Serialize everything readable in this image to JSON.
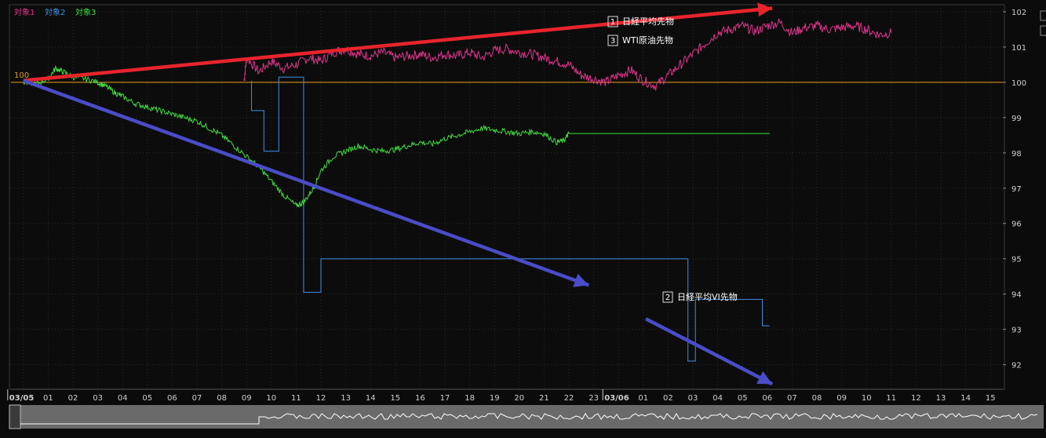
{
  "chart_data": {
    "type": "line",
    "series": [
      {
        "name": "対象1",
        "label": "日経平均先物",
        "badge": "1",
        "color": "#e0348c",
        "points": [
          [
            8.9,
            100.05
          ],
          [
            9.0,
            100.7
          ],
          [
            9.5,
            100.3
          ],
          [
            10.0,
            100.6
          ],
          [
            10.5,
            100.4
          ],
          [
            11.0,
            100.5
          ],
          [
            11.5,
            100.7
          ],
          [
            12.0,
            100.6
          ],
          [
            12.5,
            100.85
          ],
          [
            13.0,
            100.95
          ],
          [
            13.5,
            100.8
          ],
          [
            14.0,
            100.75
          ],
          [
            14.5,
            100.85
          ],
          [
            15.0,
            100.7
          ],
          [
            15.5,
            100.75
          ],
          [
            16.0,
            100.8
          ],
          [
            16.5,
            100.7
          ],
          [
            17.0,
            100.8
          ],
          [
            17.5,
            100.75
          ],
          [
            18.0,
            100.85
          ],
          [
            18.5,
            100.7
          ],
          [
            19.0,
            100.9
          ],
          [
            19.5,
            100.95
          ],
          [
            20.0,
            100.85
          ],
          [
            20.5,
            100.8
          ],
          [
            21.0,
            100.7
          ],
          [
            21.5,
            100.6
          ],
          [
            22.0,
            100.5
          ],
          [
            22.5,
            100.2
          ],
          [
            23.0,
            100.1
          ],
          [
            23.5,
            100.0
          ],
          [
            24.0,
            100.2
          ],
          [
            24.5,
            100.35
          ],
          [
            25.0,
            100.05
          ],
          [
            25.5,
            99.9
          ],
          [
            26.0,
            100.2
          ],
          [
            26.5,
            100.5
          ],
          [
            27.0,
            100.8
          ],
          [
            27.5,
            101.1
          ],
          [
            28.0,
            101.4
          ],
          [
            28.5,
            101.5
          ],
          [
            29.0,
            101.6
          ],
          [
            29.5,
            101.45
          ],
          [
            30.0,
            101.6
          ],
          [
            30.5,
            101.7
          ],
          [
            31.0,
            101.4
          ],
          [
            31.5,
            101.55
          ],
          [
            32.0,
            101.6
          ],
          [
            32.5,
            101.5
          ],
          [
            33.0,
            101.55
          ],
          [
            33.5,
            101.6
          ],
          [
            34.0,
            101.5
          ],
          [
            34.5,
            101.35
          ],
          [
            35.0,
            101.4
          ]
        ]
      },
      {
        "name": "対象2",
        "label": "日経平均VI先物",
        "badge": "2",
        "color": "#3f8fe6",
        "points": [
          [
            9.2,
            100.05
          ],
          [
            9.2,
            99.2
          ],
          [
            9.7,
            99.2
          ],
          [
            9.7,
            98.05
          ],
          [
            10.3,
            98.05
          ],
          [
            10.3,
            100.15
          ],
          [
            11.3,
            100.15
          ],
          [
            11.3,
            94.05
          ],
          [
            12.0,
            94.05
          ],
          [
            12.0,
            95.0
          ],
          [
            26.8,
            95.0
          ],
          [
            26.8,
            92.1
          ],
          [
            27.1,
            92.1
          ],
          [
            27.1,
            93.85
          ],
          [
            29.8,
            93.85
          ],
          [
            29.8,
            93.1
          ],
          [
            30.1,
            93.1
          ]
        ]
      },
      {
        "name": "対象3",
        "label": "WTI原油先物",
        "badge": "3",
        "color": "#3fdc3f",
        "points": [
          [
            0.0,
            100.0
          ],
          [
            0.5,
            99.95
          ],
          [
            1.0,
            100.1
          ],
          [
            1.3,
            100.4
          ],
          [
            1.6,
            100.3
          ],
          [
            2.0,
            100.15
          ],
          [
            2.5,
            100.1
          ],
          [
            3.0,
            100.0
          ],
          [
            3.3,
            99.9
          ],
          [
            3.7,
            99.7
          ],
          [
            4.0,
            99.6
          ],
          [
            4.5,
            99.4
          ],
          [
            5.0,
            99.3
          ],
          [
            5.5,
            99.2
          ],
          [
            6.0,
            99.1
          ],
          [
            6.5,
            99.0
          ],
          [
            7.0,
            98.9
          ],
          [
            7.5,
            98.7
          ],
          [
            8.0,
            98.5
          ],
          [
            8.5,
            98.2
          ],
          [
            9.0,
            97.9
          ],
          [
            9.5,
            97.6
          ],
          [
            10.0,
            97.2
          ],
          [
            10.5,
            96.8
          ],
          [
            11.0,
            96.5
          ],
          [
            11.3,
            96.6
          ],
          [
            11.7,
            97.0
          ],
          [
            12.0,
            97.5
          ],
          [
            12.5,
            97.9
          ],
          [
            13.0,
            98.05
          ],
          [
            13.5,
            98.2
          ],
          [
            14.0,
            98.1
          ],
          [
            14.5,
            98.05
          ],
          [
            15.0,
            98.1
          ],
          [
            15.5,
            98.2
          ],
          [
            16.0,
            98.3
          ],
          [
            16.5,
            98.25
          ],
          [
            17.0,
            98.4
          ],
          [
            17.5,
            98.5
          ],
          [
            18.0,
            98.6
          ],
          [
            18.5,
            98.7
          ],
          [
            19.0,
            98.65
          ],
          [
            19.5,
            98.6
          ],
          [
            20.0,
            98.55
          ],
          [
            20.5,
            98.6
          ],
          [
            21.0,
            98.55
          ],
          [
            21.5,
            98.3
          ],
          [
            21.8,
            98.35
          ],
          [
            22.0,
            98.55
          ],
          [
            25.0,
            98.55
          ],
          [
            30.1,
            98.55
          ]
        ]
      }
    ],
    "legend": [
      "対象1",
      "対象2",
      "対象3"
    ],
    "x_tick_labels": [
      "03/05",
      "01",
      "02",
      "03",
      "04",
      "05",
      "06",
      "07",
      "08",
      "09",
      "10",
      "11",
      "12",
      "13",
      "14",
      "15",
      "16",
      "17",
      "18",
      "19",
      "20",
      "21",
      "22",
      "23",
      "03/06",
      "01",
      "02",
      "03",
      "04",
      "05",
      "06",
      "07",
      "08",
      "09",
      "10",
      "11",
      "12",
      "13",
      "14",
      "15"
    ],
    "y_ticks": [
      92,
      93,
      94,
      95,
      96,
      97,
      98,
      99,
      100,
      101,
      102
    ],
    "ylim": [
      91.3,
      102.2
    ],
    "baseline": 100,
    "baseline_label": "100",
    "arrows": [
      {
        "name": "red-trend-arrow",
        "color": "#e8242c",
        "from": [
          0.0,
          100.05
        ],
        "to": [
          30.2,
          102.1
        ]
      },
      {
        "name": "blue-trend-arrow-upper",
        "color": "#4a4cc8",
        "from": [
          0.0,
          100.05
        ],
        "to": [
          22.8,
          94.25
        ]
      },
      {
        "name": "blue-trend-arrow-lower",
        "color": "#4a4cc8",
        "from": [
          25.1,
          93.3
        ],
        "to": [
          30.2,
          91.45
        ]
      }
    ],
    "grid": true,
    "legend_position": "top-left"
  }
}
